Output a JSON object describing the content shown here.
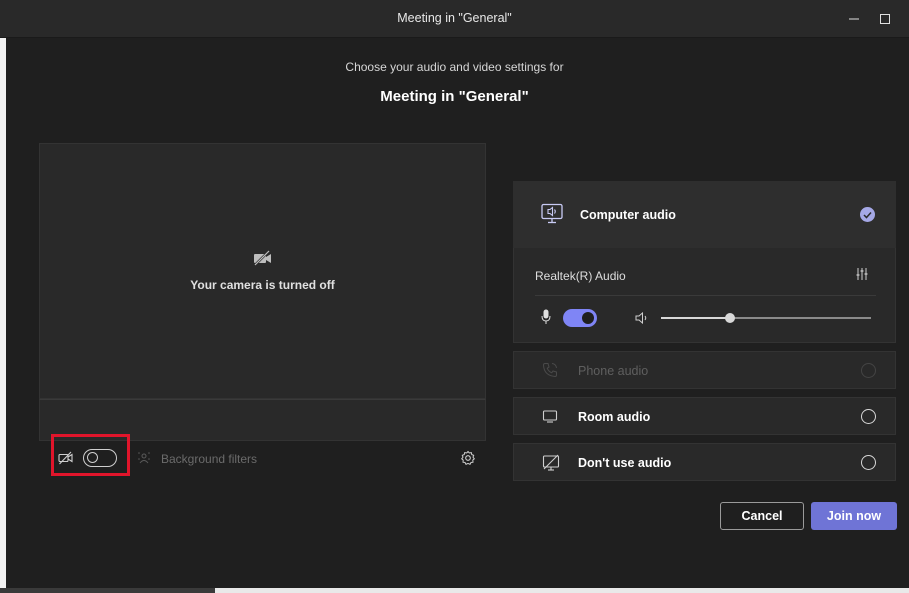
{
  "window": {
    "title": "Meeting in \"General\"",
    "minimize_icon": "minimize-icon",
    "maximize_icon": "maximize-icon"
  },
  "prejoin": {
    "subtitle": "Choose your audio and video settings for",
    "heading": "Meeting in \"General\""
  },
  "video": {
    "camera_off_text": "Your camera is turned off",
    "camera_toggle_on": false,
    "background_filters_label": "Background filters"
  },
  "audio": {
    "computer_audio_label": "Computer audio",
    "computer_audio_selected": true,
    "device_name": "Realtek(R) Audio",
    "mic_on": true,
    "speaker_volume": 0.33,
    "options": [
      {
        "label": "Phone audio",
        "enabled": false
      },
      {
        "label": "Room audio",
        "enabled": true
      },
      {
        "label": "Don't use audio",
        "enabled": true
      }
    ]
  },
  "actions": {
    "cancel_label": "Cancel",
    "join_label": "Join now"
  },
  "colors": {
    "accent": "#7f85f5",
    "join_button": "#6f74d6",
    "highlight": "#e0152b",
    "background": "#1f1f1f"
  }
}
